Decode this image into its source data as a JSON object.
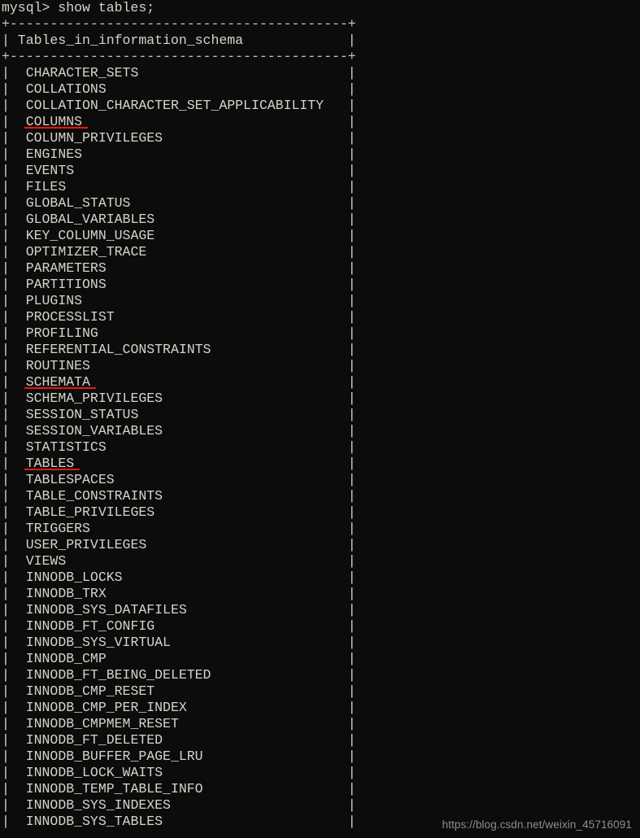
{
  "terminal": {
    "prompt": "mysql> show tables;",
    "top_rule": "+------------------------------------------+",
    "header": "| Tables_in_information_schema             |",
    "header_rule": "+------------------------------------------+",
    "column_header_label": "Tables_in_information_schema",
    "rows": [
      {
        "name": "CHARACTER_SETS",
        "underlined": false
      },
      {
        "name": "COLLATIONS",
        "underlined": false
      },
      {
        "name": "COLLATION_CHARACTER_SET_APPLICABILITY",
        "underlined": false
      },
      {
        "name": "COLUMNS",
        "underlined": true
      },
      {
        "name": "COLUMN_PRIVILEGES",
        "underlined": false
      },
      {
        "name": "ENGINES",
        "underlined": false
      },
      {
        "name": "EVENTS",
        "underlined": false
      },
      {
        "name": "FILES",
        "underlined": false
      },
      {
        "name": "GLOBAL_STATUS",
        "underlined": false
      },
      {
        "name": "GLOBAL_VARIABLES",
        "underlined": false
      },
      {
        "name": "KEY_COLUMN_USAGE",
        "underlined": false
      },
      {
        "name": "OPTIMIZER_TRACE",
        "underlined": false
      },
      {
        "name": "PARAMETERS",
        "underlined": false
      },
      {
        "name": "PARTITIONS",
        "underlined": false
      },
      {
        "name": "PLUGINS",
        "underlined": false
      },
      {
        "name": "PROCESSLIST",
        "underlined": false
      },
      {
        "name": "PROFILING",
        "underlined": false
      },
      {
        "name": "REFERENTIAL_CONSTRAINTS",
        "underlined": false
      },
      {
        "name": "ROUTINES",
        "underlined": false
      },
      {
        "name": "SCHEMATA",
        "underlined": true
      },
      {
        "name": "SCHEMA_PRIVILEGES",
        "underlined": false
      },
      {
        "name": "SESSION_STATUS",
        "underlined": false
      },
      {
        "name": "SESSION_VARIABLES",
        "underlined": false
      },
      {
        "name": "STATISTICS",
        "underlined": false
      },
      {
        "name": "TABLES",
        "underlined": true
      },
      {
        "name": "TABLESPACES",
        "underlined": false
      },
      {
        "name": "TABLE_CONSTRAINTS",
        "underlined": false
      },
      {
        "name": "TABLE_PRIVILEGES",
        "underlined": false
      },
      {
        "name": "TRIGGERS",
        "underlined": false
      },
      {
        "name": "USER_PRIVILEGES",
        "underlined": false
      },
      {
        "name": "VIEWS",
        "underlined": false
      },
      {
        "name": "INNODB_LOCKS",
        "underlined": false
      },
      {
        "name": "INNODB_TRX",
        "underlined": false
      },
      {
        "name": "INNODB_SYS_DATAFILES",
        "underlined": false
      },
      {
        "name": "INNODB_FT_CONFIG",
        "underlined": false
      },
      {
        "name": "INNODB_SYS_VIRTUAL",
        "underlined": false
      },
      {
        "name": "INNODB_CMP",
        "underlined": false
      },
      {
        "name": "INNODB_FT_BEING_DELETED",
        "underlined": false
      },
      {
        "name": "INNODB_CMP_RESET",
        "underlined": false
      },
      {
        "name": "INNODB_CMP_PER_INDEX",
        "underlined": false
      },
      {
        "name": "INNODB_CMPMEM_RESET",
        "underlined": false
      },
      {
        "name": "INNODB_FT_DELETED",
        "underlined": false
      },
      {
        "name": "INNODB_BUFFER_PAGE_LRU",
        "underlined": false
      },
      {
        "name": "INNODB_LOCK_WAITS",
        "underlined": false
      },
      {
        "name": "INNODB_TEMP_TABLE_INFO",
        "underlined": false
      },
      {
        "name": "INNODB_SYS_INDEXES",
        "underlined": false
      },
      {
        "name": "INNODB_SYS_TABLES",
        "underlined": false
      }
    ]
  },
  "watermark": {
    "text": "https://blog.csdn.net/weixin_45716091"
  },
  "colors": {
    "background": "#0c0c0c",
    "foreground": "#d6d3c8",
    "underline": "#e8170f",
    "watermark": "#8e8e8e"
  }
}
